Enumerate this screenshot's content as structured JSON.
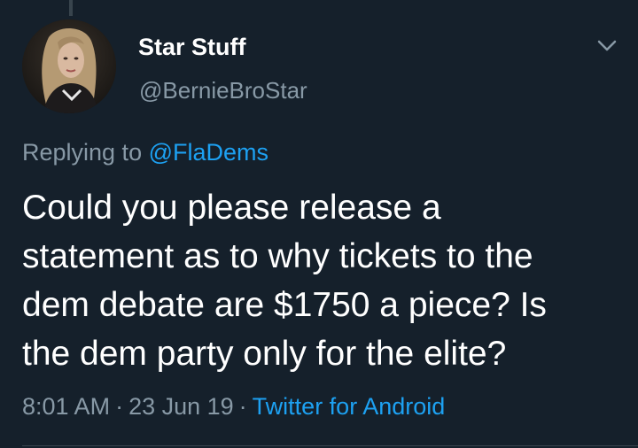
{
  "tweet": {
    "author": {
      "display_name": "Star Stuff",
      "handle": "@BernieBroStar",
      "avatar_icon": "profile-photo"
    },
    "reply_prefix": "Replying to",
    "reply_mention": "@FlaDems",
    "text_lines": [
      "Could you please release a",
      "statement as to why tickets to the",
      "dem debate are $1750 a piece? Is",
      "the dem party only for the elite?"
    ],
    "time": "8:01 AM",
    "date": "23 Jun 19",
    "separator": "·",
    "source": "Twitter for Android",
    "menu_icon": "chevron-down-icon"
  },
  "colors": {
    "background": "#15202b",
    "primary_text": "#ffffff",
    "secondary_text": "#8899a6",
    "accent": "#1da1f2",
    "divider": "#38444d"
  }
}
